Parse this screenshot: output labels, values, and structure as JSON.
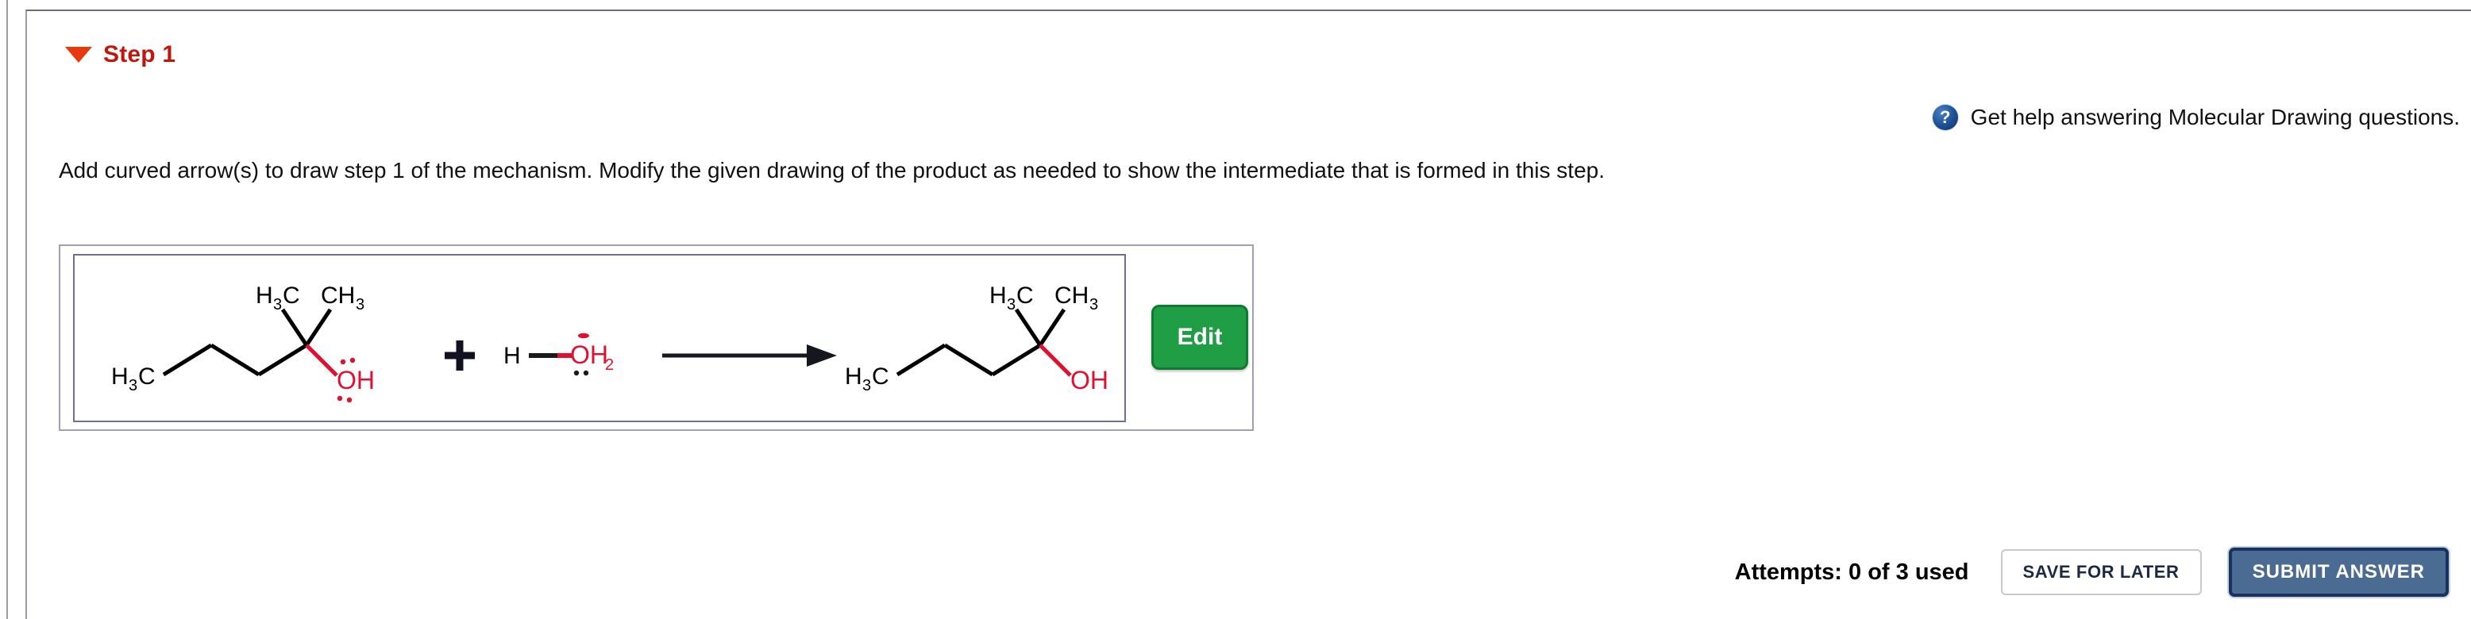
{
  "step": {
    "title": "Step 1",
    "collapse_icon": "triangle-down-icon",
    "title_color": "#c0170c"
  },
  "help": {
    "icon": "question-mark-circle-icon",
    "icon_glyph": "?",
    "text": "Get help answering Molecular Drawing questions."
  },
  "instruction": {
    "text": "Add curved arrow(s) to draw step 1 of the mechanism. Modify the given drawing of the product as needed to show the intermediate that is formed in this step."
  },
  "drawing": {
    "edit_button_label": "Edit",
    "plus_sign": "+",
    "arrow": "reaction-arrow-right",
    "reactant_1": {
      "name": "2-methyl-2-pentanol",
      "labels": [
        "H",
        "3",
        "C",
        "H",
        "3",
        "C",
        "CH",
        "3",
        "O",
        "H"
      ],
      "left_label": "H₃C",
      "top_left_label": "H₃C",
      "top_right_label": "CH₃",
      "hydroxyl_label": "OH",
      "hydroxyl_color": "#e11030",
      "lone_pairs": "two"
    },
    "reactant_2": {
      "name": "hydronium",
      "h_label": "H",
      "o_label": "O",
      "h2_label": "H",
      "h2_subscript": "2",
      "color": "#e11030",
      "lone_pairs": "one-below-one-above"
    },
    "product": {
      "name": "2-methyl-2-pentanol",
      "left_label": "H₃C",
      "top_left_label": "H₃C",
      "top_right_label": "CH₃",
      "hydroxyl_label": "OH",
      "hydroxyl_color": "#e11030",
      "lone_pairs": "none"
    }
  },
  "footer": {
    "attempts_text": "Attempts: 0 of 3 used",
    "save_label": "SAVE FOR LATER",
    "submit_label": "SUBMIT ANSWER",
    "submit_color": "#4a6c92"
  }
}
